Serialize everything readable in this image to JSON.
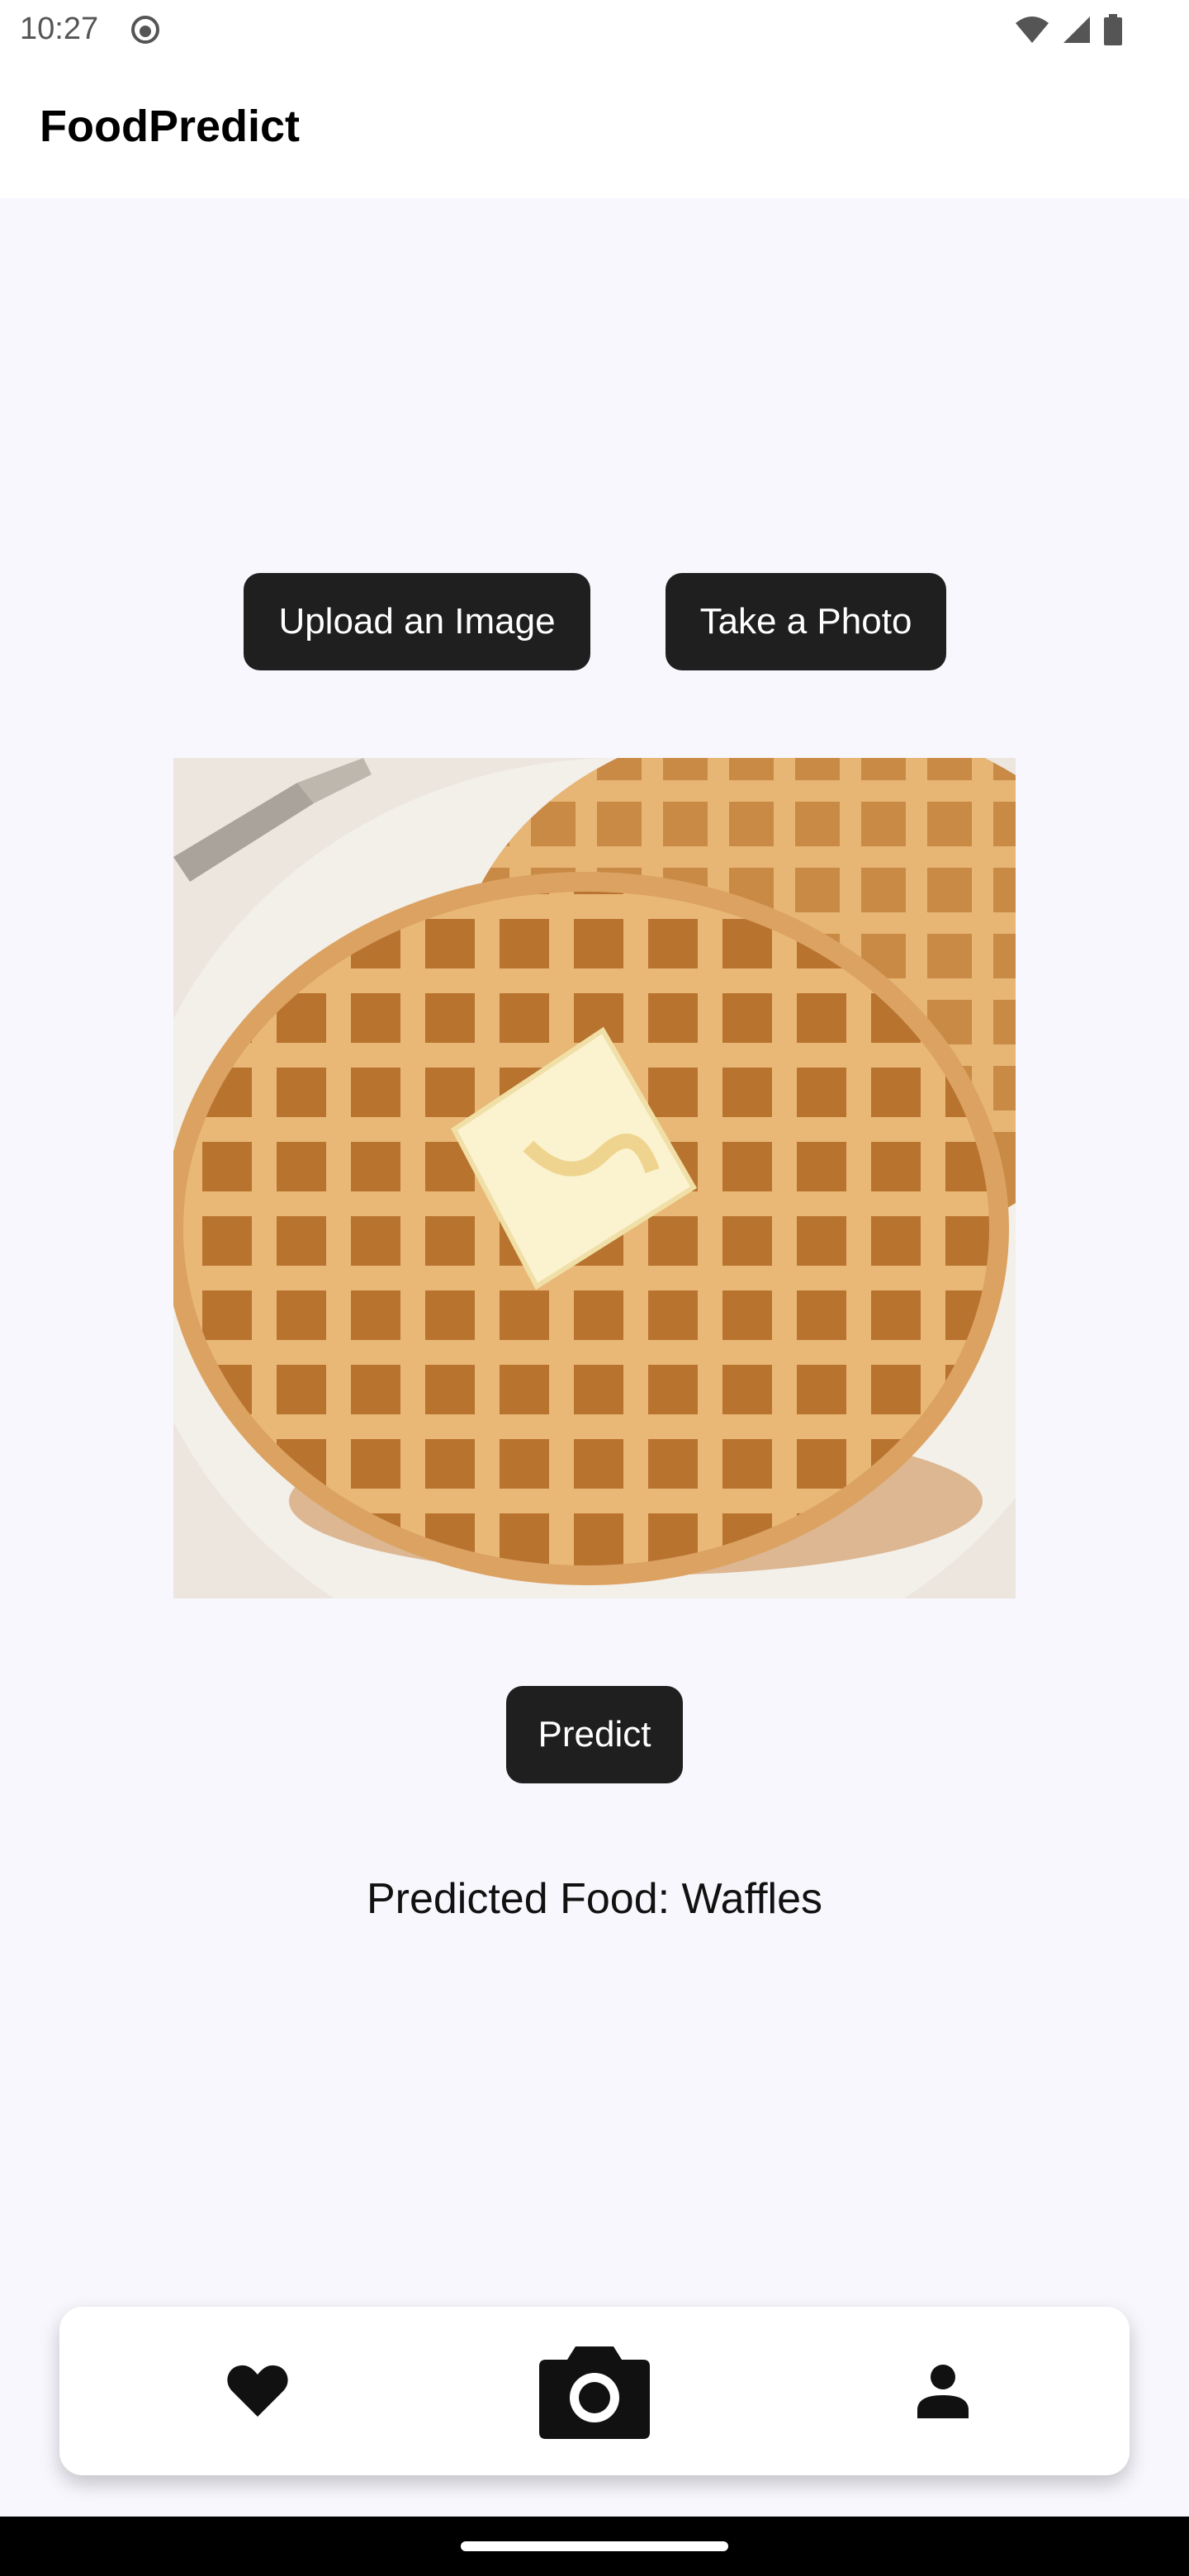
{
  "status_bar": {
    "time": "10:27"
  },
  "app_bar": {
    "title": "FoodPredict"
  },
  "actions": {
    "upload_label": "Upload an Image",
    "photo_label": "Take a Photo",
    "predict_label": "Predict"
  },
  "prediction": {
    "text": "Predicted Food: Waffles"
  },
  "bottom_nav": {
    "items": [
      {
        "icon": "heart-icon"
      },
      {
        "icon": "camera-icon"
      },
      {
        "icon": "person-icon"
      }
    ]
  },
  "colors": {
    "background": "#f8f7fd",
    "button": "#1f1f1f",
    "button_text": "#ffffff"
  }
}
